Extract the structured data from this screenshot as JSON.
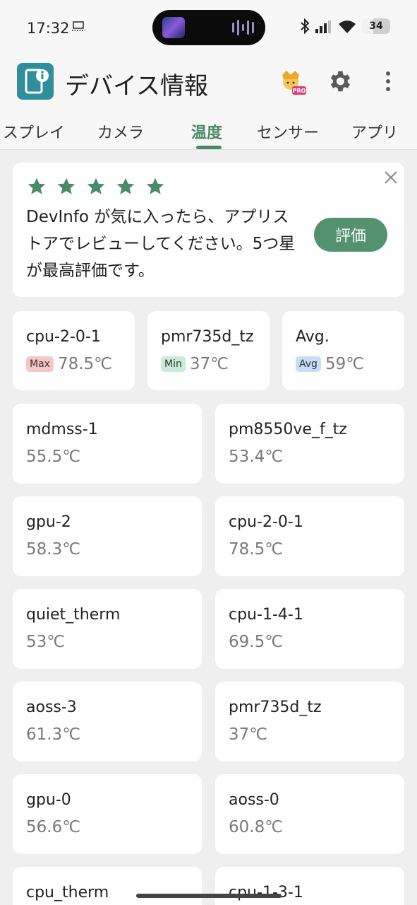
{
  "status_bar": {
    "time": "17:32",
    "battery": "34"
  },
  "app_bar": {
    "title": "デバイス情報",
    "pro_label": "PRO"
  },
  "tabs": [
    {
      "label": "スプレイ"
    },
    {
      "label": "カメラ"
    },
    {
      "label": "温度",
      "active": true
    },
    {
      "label": "センサー"
    },
    {
      "label": "アプリ"
    }
  ],
  "review": {
    "stars": 5,
    "text": "DevInfo が気に入ったら、アプリストアでレビューしてください。5つ星が最高評価です。",
    "button": "評価"
  },
  "summary": [
    {
      "name": "cpu-2-0-1",
      "badge": "Max",
      "value": "78.5℃"
    },
    {
      "name": "pmr735d_tz",
      "badge": "Min",
      "value": "37℃"
    },
    {
      "name": "Avg.",
      "badge": "Avg",
      "value": "59℃"
    }
  ],
  "sensors": [
    {
      "name": "mdmss-1",
      "value": "55.5℃"
    },
    {
      "name": "pm8550ve_f_tz",
      "value": "53.4℃"
    },
    {
      "name": "gpu-2",
      "value": "58.3℃"
    },
    {
      "name": "cpu-2-0-1",
      "value": "78.5℃"
    },
    {
      "name": "quiet_therm",
      "value": "53℃"
    },
    {
      "name": "cpu-1-4-1",
      "value": "69.5℃"
    },
    {
      "name": "aoss-3",
      "value": "61.3℃"
    },
    {
      "name": "pmr735d_tz",
      "value": "37℃"
    },
    {
      "name": "gpu-0",
      "value": "56.6℃"
    },
    {
      "name": "aoss-0",
      "value": "60.8℃"
    },
    {
      "name": "cpu_therm",
      "value": ""
    },
    {
      "name": "cpu-1-3-1",
      "value": ""
    }
  ],
  "colors": {
    "accent": "#54916f",
    "star": "#4b8a68",
    "background": "#efefef"
  }
}
